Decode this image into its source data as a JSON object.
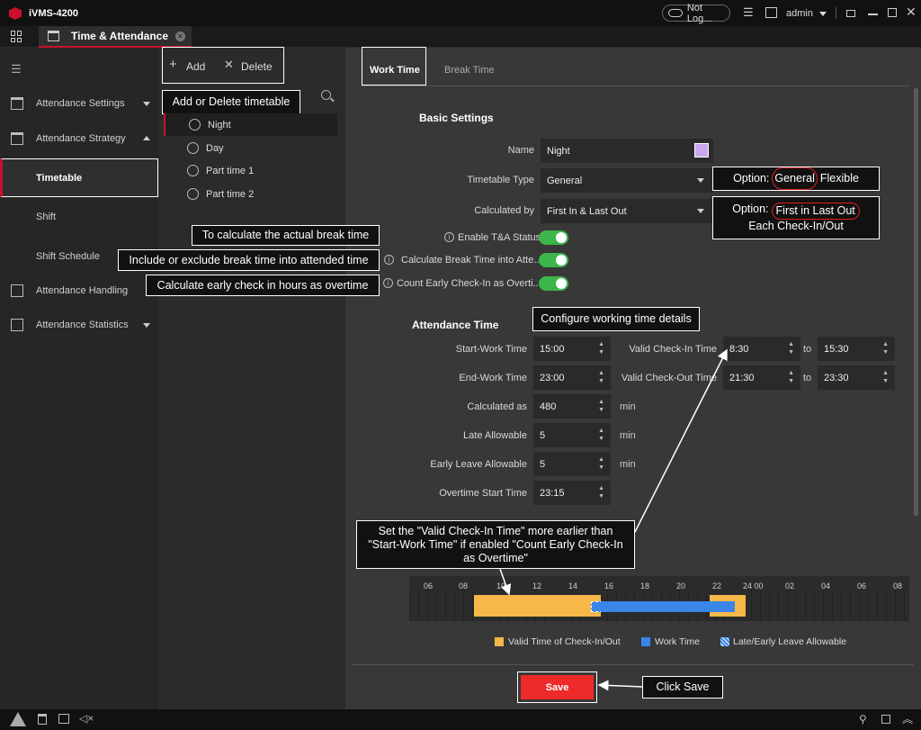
{
  "app": {
    "name": "iVMS-4200",
    "cloud_status": "Not Log...",
    "user": "admin"
  },
  "tab": {
    "label": "Time & Attendance"
  },
  "sidebar": {
    "items": [
      {
        "label": "Attendance Settings"
      },
      {
        "label": "Attendance Strategy"
      },
      {
        "label": "Timetable"
      },
      {
        "label": "Shift"
      },
      {
        "label": "Shift Schedule"
      },
      {
        "label": "Attendance Handling"
      },
      {
        "label": "Attendance Statistics"
      }
    ]
  },
  "toolbar": {
    "add_label": "Add",
    "delete_label": "Delete"
  },
  "timetables": [
    "Night",
    "Day",
    "Part time 1",
    "Part time 2"
  ],
  "tabs": {
    "work_time": "Work Time",
    "break_time": "Break Time"
  },
  "basic": {
    "heading": "Basic Settings",
    "name_label": "Name",
    "name_value": "Night",
    "name_color": "#c9a7f0",
    "type_label": "Timetable Type",
    "type_value": "General",
    "calc_label": "Calculated by",
    "calc_value": "First In & Last Out",
    "enable_label": "Enable T&A Status",
    "break_label": "Calculate Break Time into Atte...",
    "early_label": "Count Early Check-In as Overti..."
  },
  "attendance": {
    "heading": "Attendance Time",
    "start_label": "Start-Work Time",
    "start_value": "15:00",
    "end_label": "End-Work Time",
    "end_value": "23:00",
    "calc_label": "Calculated as",
    "calc_value": "480",
    "calc_unit": "min",
    "late_label": "Late Allowable",
    "late_value": "5",
    "late_unit": "min",
    "leave_label": "Early Leave Allowable",
    "leave_value": "5",
    "leave_unit": "min",
    "ot_label": "Overtime Start Time",
    "ot_value": "23:15",
    "checkin_label": "Valid Check-In Time",
    "checkin_from": "8:30",
    "checkin_to": "15:30",
    "checkout_label": "Valid Check-Out Time",
    "checkout_from": "21:30",
    "checkout_to": "23:30",
    "to_label": "to"
  },
  "timeline": {
    "ticks": [
      "06",
      "08",
      "10",
      "12",
      "14",
      "16",
      "18",
      "20",
      "22",
      "24 00",
      "02",
      "04",
      "06",
      "08"
    ]
  },
  "legend": {
    "valid": "Valid Time of Check-In/Out",
    "work": "Work Time",
    "allow": "Late/Early Leave Allowable"
  },
  "colors": {
    "valid": "#f5b849",
    "work": "#3a85e8",
    "toggle": "#3cb54a",
    "save": "#ee2a2a",
    "accent": "#c8102e"
  },
  "save_label": "Save",
  "callouts": {
    "add_delete": "Add or Delete timetable",
    "type_opts_a": "Option:",
    "type_opts_b": "General",
    "type_opts_c": "Flexible",
    "calc_opts_a": "Option:",
    "calc_opts_b": "First in Last Out",
    "calc_opts_c": "Each Check-In/Out",
    "actual_break": "To calculate the actual break time",
    "include_break": "Include or exclude break time into attended time",
    "early_ot": "Calculate early check in hours as overtime",
    "configure": "Configure working time details",
    "valid_note": "Set the \"Valid Check-In Time\" more earlier than \"Start-Work Time\" if enabled \"Count Early Check-In as Overtime\"",
    "click_save": "Click Save"
  }
}
